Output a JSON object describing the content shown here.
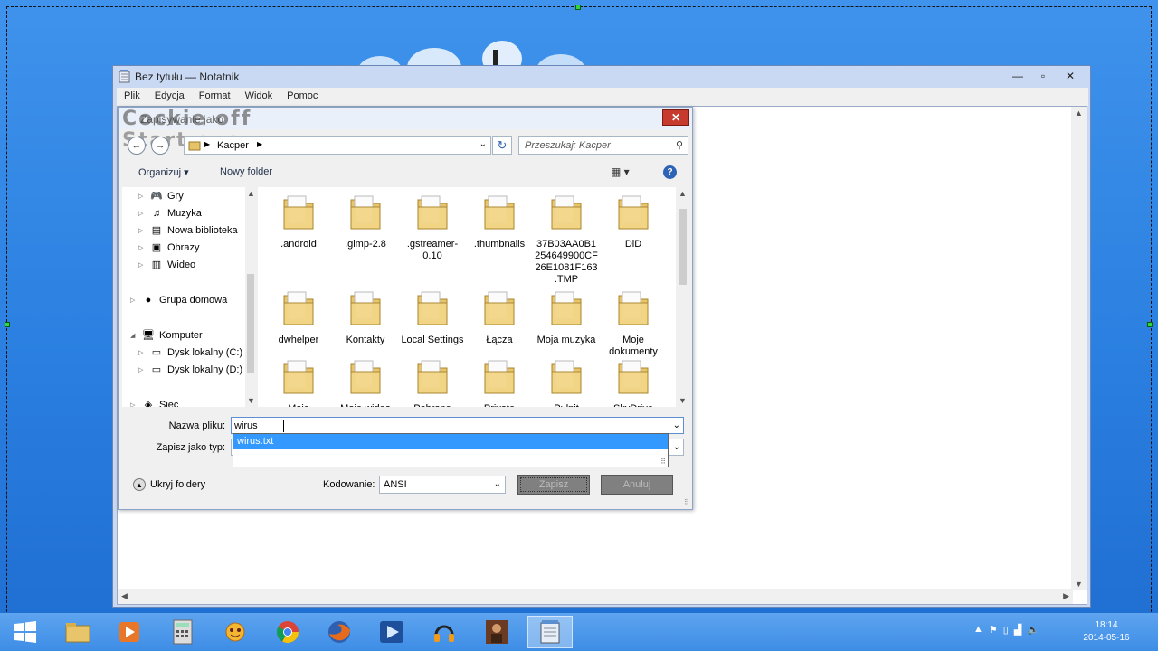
{
  "notepad": {
    "title": "Bez tytułu — Notatnik",
    "menu": [
      "Plik",
      "Edycja",
      "Format",
      "Widok",
      "Pomoc"
    ],
    "window_buttons": [
      "minimize-icon",
      "maximize-icon",
      "close-icon"
    ]
  },
  "dialog": {
    "title": "Zapisywanie jako",
    "overlay_text_line1": "Cockie off",
    "overlay_text_line2": "Start exe",
    "breadcrumb": "Kacper",
    "search_placeholder": "Przeszukaj: Kacper",
    "toolbar": {
      "organize": "Organizuj ▾",
      "new_folder": "Nowy folder"
    },
    "nav_items": [
      {
        "label": "Gry",
        "icon": "games-icon",
        "level": 1
      },
      {
        "label": "Muzyka",
        "icon": "music-icon",
        "level": 1
      },
      {
        "label": "Nowa biblioteka",
        "icon": "library-icon",
        "level": 1
      },
      {
        "label": "Obrazy",
        "icon": "pictures-icon",
        "level": 1
      },
      {
        "label": "Wideo",
        "icon": "video-icon",
        "level": 1
      },
      {
        "label": "Grupa domowa",
        "icon": "homegroup-icon",
        "level": 0
      },
      {
        "label": "Komputer",
        "icon": "computer-icon",
        "level": 0
      },
      {
        "label": "Dysk lokalny (C:)",
        "icon": "drive-icon",
        "level": 1
      },
      {
        "label": "Dysk lokalny (D:)",
        "icon": "drive-icon",
        "level": 1
      },
      {
        "label": "Sieć",
        "icon": "network-icon",
        "level": 0
      }
    ],
    "files": [
      {
        "name": ".android"
      },
      {
        "name": ".gimp-2.8"
      },
      {
        "name": ".gstreamer-0.10"
      },
      {
        "name": ".thumbnails"
      },
      {
        "name": "37B03AA0B1254649900CF26E1081F163.TMP"
      },
      {
        "name": "DiD"
      },
      {
        "name": "dwhelper"
      },
      {
        "name": "Kontakty"
      },
      {
        "name": "Local Settings"
      },
      {
        "name": "Łącza"
      },
      {
        "name": "Moja muzyka"
      },
      {
        "name": "Moje dokumenty"
      },
      {
        "name": "Moje"
      },
      {
        "name": "Moje wideo"
      },
      {
        "name": "Pobrane"
      },
      {
        "name": "Private"
      },
      {
        "name": "Pulpit"
      },
      {
        "name": "SkyDrive"
      }
    ],
    "file_name_label": "Nazwa pliku:",
    "file_name_value": "wirus",
    "autocomplete_option": "wirus.txt",
    "save_type_label": "Zapisz jako typ:",
    "hide_folders": "Ukryj foldery",
    "encoding_label": "Kodowanie:",
    "encoding_value": "ANSI",
    "save_button": "Zapisz",
    "cancel_button": "Anuluj"
  },
  "taskbar": {
    "clock_time": "18:14",
    "clock_date": "2014-05-16",
    "apps": [
      "windows-start-icon",
      "file-explorer-icon",
      "media-player-icon",
      "calculator-icon",
      "game-icon",
      "chrome-icon",
      "firefox-icon",
      "media-center-icon",
      "headphones-icon",
      "character-icon",
      "notepad-icon"
    ]
  },
  "colors": {
    "desktop": "#2b7fdf",
    "selection": "#3399ff",
    "close_button": "#c73b2f"
  }
}
